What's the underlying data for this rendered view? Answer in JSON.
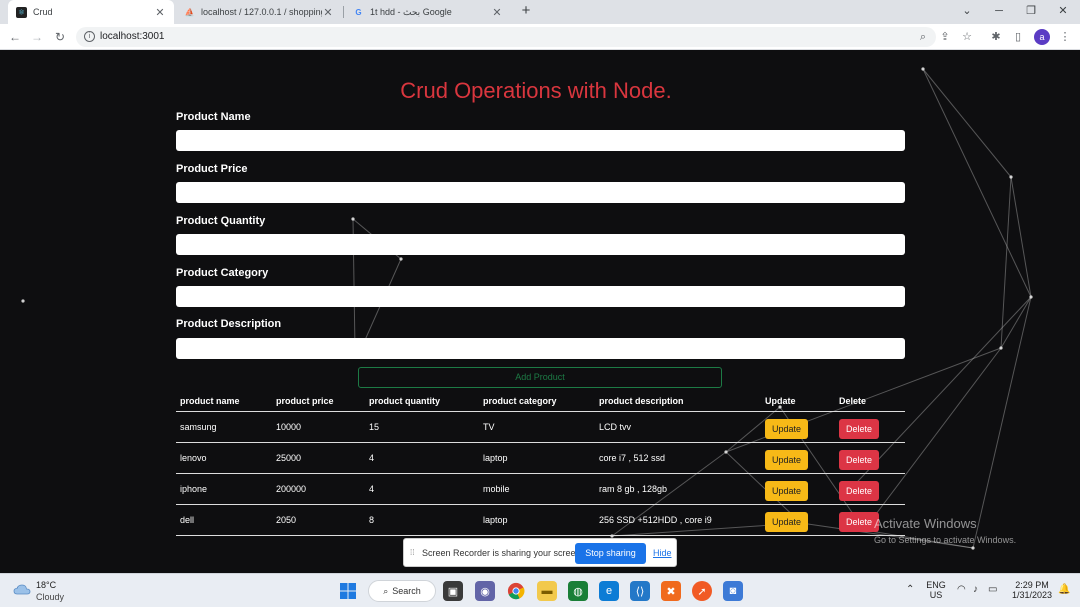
{
  "browser": {
    "tabs": [
      {
        "title": "Crud",
        "active": true
      },
      {
        "title": "localhost / 127.0.0.1 / shopping",
        "active": false
      },
      {
        "title": "1t hdd - بحث Google",
        "active": false
      }
    ],
    "new_tab": "+",
    "url": "localhost:3001"
  },
  "page": {
    "title": "Crud Operations with Node.",
    "form": {
      "fields": [
        {
          "label": "Product Name",
          "value": ""
        },
        {
          "label": "Product Price",
          "value": ""
        },
        {
          "label": "Product Quantity",
          "value": ""
        },
        {
          "label": "Product Category",
          "value": ""
        },
        {
          "label": "Product Description",
          "value": ""
        }
      ],
      "submit_label": "Add Product"
    },
    "table": {
      "headers": [
        "product name",
        "product price",
        "product quantity",
        "product category",
        "product description",
        "Update",
        "Delete"
      ],
      "rows": [
        {
          "name": "samsung",
          "price": "10000",
          "quantity": "15",
          "category": "TV",
          "description": "LCD tvv"
        },
        {
          "name": "lenovo",
          "price": "25000",
          "quantity": "4",
          "category": "laptop",
          "description": "core i7 , 512 ssd"
        },
        {
          "name": "iphone",
          "price": "200000",
          "quantity": "4",
          "category": "mobile",
          "description": "ram 8 gb , 128gb"
        },
        {
          "name": "dell",
          "price": "2050",
          "quantity": "8",
          "category": "laptop",
          "description": "256 SSD +512HDD , core i9"
        }
      ],
      "update_label": "Update",
      "delete_label": "Delete"
    },
    "colors": {
      "title": "#d9363e",
      "update": "#f7b917",
      "delete": "#dc3545",
      "add_border": "#1d7a45"
    }
  },
  "watermark": {
    "line1": "Activate Windows",
    "line2": "Go to Settings to activate Windows."
  },
  "screen_share": {
    "message": "Screen Recorder is sharing your screen.",
    "stop_label": "Stop sharing",
    "hide_label": "Hide"
  },
  "taskbar": {
    "weather_temp": "18°C",
    "weather_cond": "Cloudy",
    "search_label": "Search",
    "lang_line1": "ENG",
    "lang_line2": "US",
    "time": "2:29 PM",
    "date": "1/31/2023"
  }
}
